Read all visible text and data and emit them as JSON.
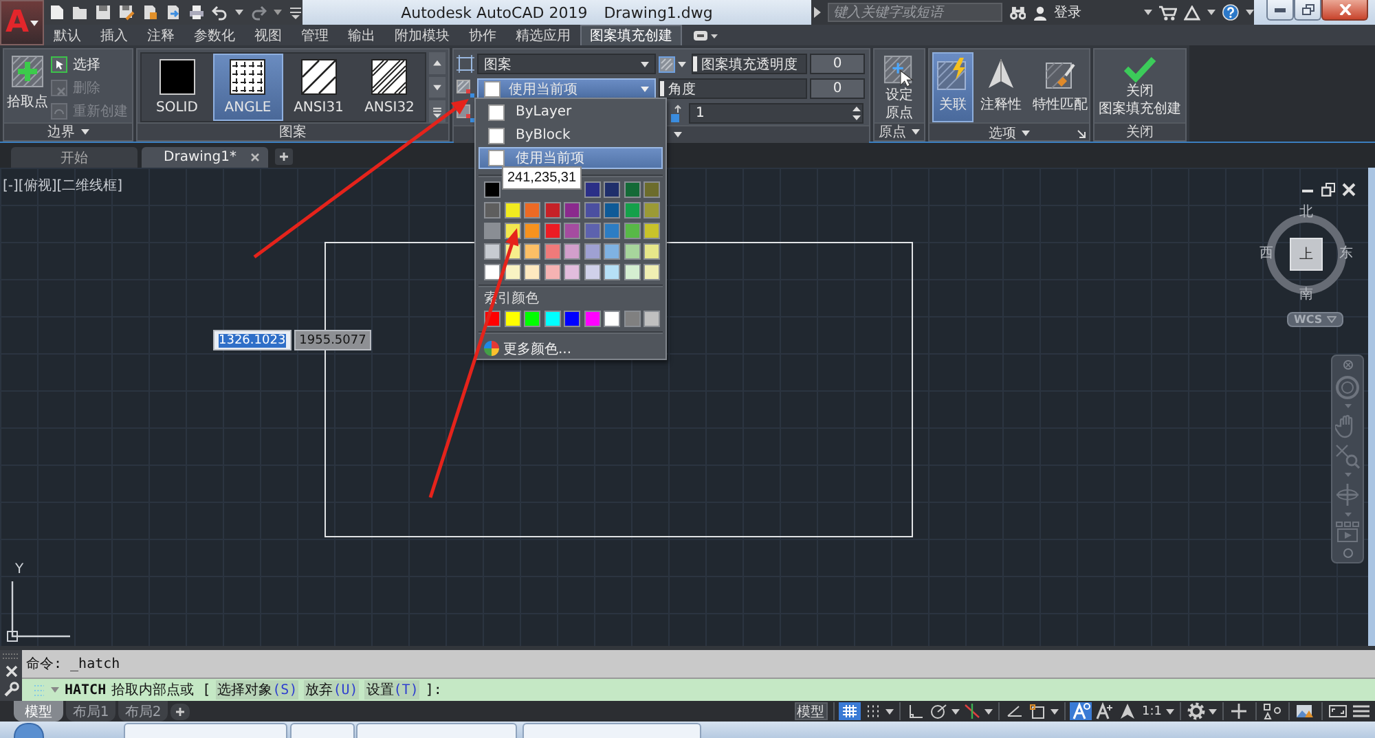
{
  "app_menu": {
    "label": "A"
  },
  "title_bar": {
    "app": "Autodesk AutoCAD 2019",
    "file": "Drawing1.dwg",
    "search": {
      "placeholder": "键入关键字或短语"
    },
    "sign_in": "登录"
  },
  "ribbon_tabs": [
    {
      "label": "默认",
      "selected": false
    },
    {
      "label": "插入",
      "selected": false
    },
    {
      "label": "注释",
      "selected": false
    },
    {
      "label": "参数化",
      "selected": false
    },
    {
      "label": "视图",
      "selected": false
    },
    {
      "label": "管理",
      "selected": false
    },
    {
      "label": "输出",
      "selected": false
    },
    {
      "label": "附加模块",
      "selected": false
    },
    {
      "label": "协作",
      "selected": false
    },
    {
      "label": "精选应用",
      "selected": false
    },
    {
      "label": "图案填充创建",
      "selected": true
    }
  ],
  "boundary_panel": {
    "title": "边界",
    "pick_points": "拾取点",
    "tools": [
      {
        "kind": "select",
        "label": "选择",
        "disabled": false
      },
      {
        "kind": "remove",
        "label": "删除",
        "disabled": true
      },
      {
        "kind": "recreate",
        "label": "重新创建",
        "disabled": true
      }
    ]
  },
  "pattern_panel": {
    "title": "图案",
    "patterns": [
      {
        "kind": "solid",
        "label": "SOLID",
        "selected": false
      },
      {
        "kind": "angle",
        "label": "ANGLE",
        "selected": true
      },
      {
        "kind": "ansi31",
        "label": "ANSI31",
        "selected": false
      },
      {
        "kind": "ansi32",
        "label": "ANSI32",
        "selected": false
      }
    ]
  },
  "properties_panel": {
    "hatch_type": "图案",
    "hatch_color": {
      "value": "使用当前项",
      "expanded": true
    },
    "transparency": {
      "label": "图案填充透明度",
      "value": "0",
      "level": 0
    },
    "angle": {
      "label": "角度",
      "value": "0",
      "level": 0
    },
    "scale": {
      "value": "1"
    }
  },
  "origin_panel": {
    "title": "原点",
    "button": [
      "设定",
      "原点"
    ]
  },
  "options_panel": {
    "title": "选项",
    "buttons": [
      {
        "kind": "associative",
        "label": "关联",
        "selected": true
      },
      {
        "kind": "annotative",
        "label": "注释性",
        "selected": false
      },
      {
        "kind": "match",
        "label": "特性匹配",
        "selected": false
      }
    ]
  },
  "close_panel": {
    "title": "关闭",
    "button": [
      "关闭",
      "图案填充创建"
    ]
  },
  "file_tabs": [
    {
      "label": "开始",
      "selected": false
    },
    {
      "label": "Drawing1*",
      "selected": true
    }
  ],
  "viewport": {
    "label": "[-][俯视][二维线框]",
    "ucs_axis": "Y",
    "dynamic_input": [
      {
        "value": "1326.1023",
        "selected": true
      },
      {
        "value": "1955.5077",
        "selected": false
      }
    ],
    "viewcube": {
      "north": "北",
      "south": "南",
      "west": "西",
      "east": "东",
      "face": "上",
      "coordinate_system": "WCS"
    }
  },
  "color_dropdown": {
    "options": [
      {
        "label": "ByLayer",
        "selected": false
      },
      {
        "label": "ByBlock",
        "selected": false
      },
      {
        "label": "使用当前项",
        "selected": true
      }
    ],
    "palette": [
      [
        {
          "color": "#000000"
        },
        {
          "color": "#2b2f87"
        },
        {
          "color": "#1f2f6b"
        },
        {
          "color": "#146a37"
        },
        {
          "color": "#6c6c2c"
        }
      ],
      [
        {
          "color": "#5e5e5e"
        },
        {
          "color": "#f1eb1f"
        },
        {
          "color": "#ec6a24"
        },
        {
          "color": "#c62127"
        },
        {
          "color": "#8b2a8d"
        },
        {
          "color": "#4b4fa0"
        },
        {
          "color": "#0e5a97"
        },
        {
          "color": "#15a04a"
        },
        {
          "color": "#9b9a35"
        }
      ],
      [
        {
          "color": "#8a8e94"
        },
        {
          "color": "#f3e74f"
        },
        {
          "color": "#f7921e"
        },
        {
          "color": "#ec1c24"
        },
        {
          "color": "#a54ca0"
        },
        {
          "color": "#5d62ae"
        },
        {
          "color": "#2d7dc3"
        },
        {
          "color": "#58b947"
        },
        {
          "color": "#c9c32a"
        }
      ],
      [
        {
          "color": "#c7cbd1"
        },
        {
          "color": "#f6ef8c"
        },
        {
          "color": "#fdbf66"
        },
        {
          "color": "#f07a7a"
        },
        {
          "color": "#d29fcb"
        },
        {
          "color": "#9fa1d3"
        },
        {
          "color": "#7fb2e2"
        },
        {
          "color": "#a7d59c"
        },
        {
          "color": "#e7e78a"
        }
      ],
      [
        {
          "color": "#ffffff"
        },
        {
          "color": "#f8f3c3"
        },
        {
          "color": "#fee9c0"
        },
        {
          "color": "#f6b3b3"
        },
        {
          "color": "#e2bddd"
        },
        {
          "color": "#d0d1ea"
        },
        {
          "color": "#b6e0f7"
        },
        {
          "color": "#d5eed1"
        },
        {
          "color": "#f0efb3"
        }
      ]
    ],
    "tooltip": "241,235,31",
    "index_colors_label": "索引颜色",
    "index_colors": [
      {
        "color": "#ff0000"
      },
      {
        "color": "#ffff00"
      },
      {
        "color": "#00ff00"
      },
      {
        "color": "#00ffff"
      },
      {
        "color": "#0000ff"
      },
      {
        "color": "#ff00ff"
      },
      {
        "color": "#ffffff"
      },
      {
        "color": "#808080"
      },
      {
        "color": "#c0c0c0"
      }
    ],
    "more_colors": "更多颜色..."
  },
  "command_line": {
    "history": "命令: _hatch",
    "command": "HATCH",
    "prompt": "拾取内部点或 [",
    "options": [
      {
        "label": "选择对象",
        "key": "(S)"
      },
      {
        "label": "放弃",
        "key": "(U)"
      },
      {
        "label": "设置",
        "key": "(T)"
      }
    ],
    "prompt_end": "]:"
  },
  "layout_tabs": [
    {
      "label": "模型",
      "selected": true
    },
    {
      "label": "布局1",
      "selected": false
    },
    {
      "label": "布局2",
      "selected": false
    }
  ],
  "status_bar": {
    "space": "模型",
    "tool_groups": [
      [
        {
          "kind": "grid",
          "on": true,
          "menu": false
        },
        {
          "kind": "snap",
          "on": false,
          "menu": true
        }
      ],
      [
        {
          "kind": "ortho",
          "on": false,
          "menu": false
        },
        {
          "kind": "polar",
          "on": false,
          "menu": true
        },
        {
          "kind": "isodraft",
          "on": false,
          "menu": true
        }
      ],
      [
        {
          "kind": "otrack",
          "on": false,
          "menu": false
        },
        {
          "kind": "osnap",
          "on": false,
          "menu": true
        }
      ],
      [
        {
          "kind": "annovis",
          "on": true,
          "menu": false
        },
        {
          "kind": "autoscale",
          "on": false,
          "menu": false
        },
        {
          "kind": "annoscale",
          "on": false,
          "menu": false
        },
        {
          "kind": "scale",
          "label": "1:1",
          "on": false,
          "menu": true
        }
      ],
      [
        {
          "kind": "workspace",
          "on": false,
          "menu": true
        }
      ],
      [
        {
          "kind": "plus",
          "on": false,
          "menu": false
        }
      ],
      [
        {
          "kind": "isolate",
          "on": false,
          "menu": false
        }
      ],
      [
        {
          "kind": "hardware",
          "on": false,
          "menu": false
        }
      ],
      [
        {
          "kind": "cleanscreen",
          "on": false,
          "menu": false
        },
        {
          "kind": "customize",
          "on": false,
          "menu": false
        }
      ]
    ]
  }
}
